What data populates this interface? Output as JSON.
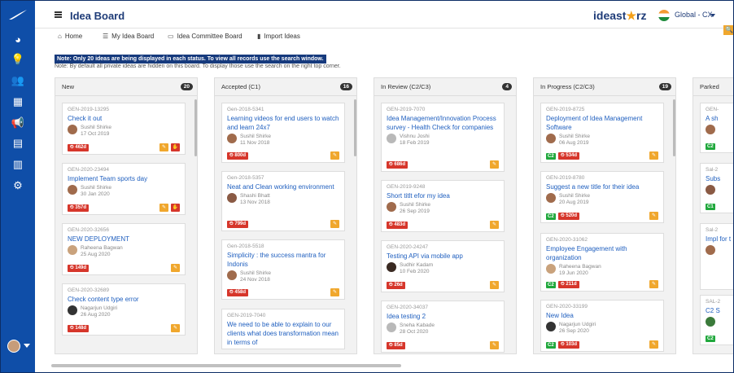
{
  "app": {
    "title": "Idea Board",
    "brand_main": "ideast",
    "brand_accent": "★",
    "brand_tail": "rz",
    "region": "Global - CX"
  },
  "nav": [
    {
      "label": "Home",
      "icon": "home-icon"
    },
    {
      "label": "My Idea Board",
      "icon": "list-icon"
    },
    {
      "label": "Idea Committee Board",
      "icon": "committee-icon"
    },
    {
      "label": "Import Ideas",
      "icon": "import-icon"
    }
  ],
  "notes": {
    "primary": "Note: Only 20 ideas are being displayed in each status. To view all records use the search window.",
    "secondary": "Note: By default all private ideas are hidden on this board. To display those use the search on the right top corner."
  },
  "columns": [
    {
      "title": "New",
      "count": "20",
      "cards": [
        {
          "id": "GEN-2019-13295",
          "title": "Check it out",
          "author": "Sushil Shirke",
          "date": "17 Oct 2019",
          "days": "462d",
          "stage": ""
        },
        {
          "id": "GEN-2020-23494",
          "title": "Implement Team sports day",
          "author": "Sushil Shirke",
          "date": "30 Jan 2020",
          "days": "357d",
          "stage": ""
        },
        {
          "id": "GEN-2020-32656",
          "title": "NEW DEPLOYMENT",
          "author": "Raheena Bagwan",
          "date": "25 Aug 2020",
          "days": "149d",
          "stage": ""
        },
        {
          "id": "GEN-2020-32689",
          "title": "Check content type error",
          "author": "Nagarjun Udgiri",
          "date": "26 Aug 2020",
          "days": "148d",
          "stage": ""
        }
      ]
    },
    {
      "title": "Accepted (C1)",
      "count": "16",
      "cards": [
        {
          "id": "Gen-2018-5341",
          "title": "Learning videos for end users to watch and learn 24x7",
          "author": "Sushil Shirke",
          "date": "11 Nov 2018",
          "days": "800d",
          "stage": ""
        },
        {
          "id": "Gen-2018-5357",
          "title": "Neat and Clean working environment",
          "author": "Shashi Bhatt",
          "date": "13 Nov 2018",
          "days": "799d",
          "stage": ""
        },
        {
          "id": "Gen-2018-5518",
          "title": "Simplicity : the success mantra for Indonis",
          "author": "Sushil Shirke",
          "date": "24 Nov 2018",
          "days": "458d",
          "stage": ""
        },
        {
          "id": "GEN-2019-7040",
          "title": "We need to be able to explain to our clients what does transformation mean in terms of",
          "author": "",
          "date": "",
          "days": "",
          "stage": ""
        }
      ]
    },
    {
      "title": "In Review (C2/C3)",
      "count": "4",
      "cards": [
        {
          "id": "GEN-2019-7070",
          "title": "Idea Management/Innovation Process survey - Health Check for companies",
          "author": "Vishnu Joshi",
          "date": "18 Feb 2019",
          "days": "686d",
          "stage": ""
        },
        {
          "id": "GEN-2019-9248",
          "title": "Short titlt efor my idea",
          "author": "Sushil Shirke",
          "date": "26 Sep 2019",
          "days": "483d",
          "stage": ""
        },
        {
          "id": "GEN-2020-24247",
          "title": "Testing API via mobile app",
          "author": "Sudhir Kadam",
          "date": "10 Feb 2020",
          "days": "26d",
          "stage": ""
        },
        {
          "id": "GEN-2020-34037",
          "title": "Idea testing 2",
          "author": "Sneha Kabade",
          "date": "28 Oct 2020",
          "days": "85d",
          "stage": ""
        }
      ]
    },
    {
      "title": "In Progress (C2/C3)",
      "count": "19",
      "cards": [
        {
          "id": "GEN-2019-8725",
          "title": "Deployment of Idea Management Software",
          "author": "Sushil Shirke",
          "date": "06 Aug 2019",
          "days": "534d",
          "stage": "C2"
        },
        {
          "id": "GEN-2019-8780",
          "title": "Suggest a new title for their idea",
          "author": "Sushil Shirke",
          "date": "20 Aug 2019",
          "days": "520d",
          "stage": "C2"
        },
        {
          "id": "GEN-2020-31062",
          "title": "Employee Engagement with organization",
          "author": "Raheena Bagwan",
          "date": "19 Jun 2020",
          "days": "211d",
          "stage": "C2"
        },
        {
          "id": "GEN-2020-33199",
          "title": "New Idea",
          "author": "Nagarjun Udgiri",
          "date": "26 Sep 2020",
          "days": "103d",
          "stage": "C2"
        }
      ]
    },
    {
      "title": "Parked",
      "cards": [
        {
          "id": "GEN-",
          "title": "A sh",
          "stage": "C2"
        },
        {
          "id": "Sal-2",
          "title": "Subs",
          "stage": "C1"
        },
        {
          "id": "Sal-2",
          "title": "Impl for t",
          "stage": ""
        },
        {
          "id": "SAL-2",
          "title": "C2 S",
          "stage": "C2"
        }
      ]
    }
  ],
  "colors": {
    "sidebar": "#0f4ea8",
    "accent": "#f0a72d",
    "danger": "#d6362b",
    "success": "#20a83c",
    "link": "#1f5fbf"
  }
}
